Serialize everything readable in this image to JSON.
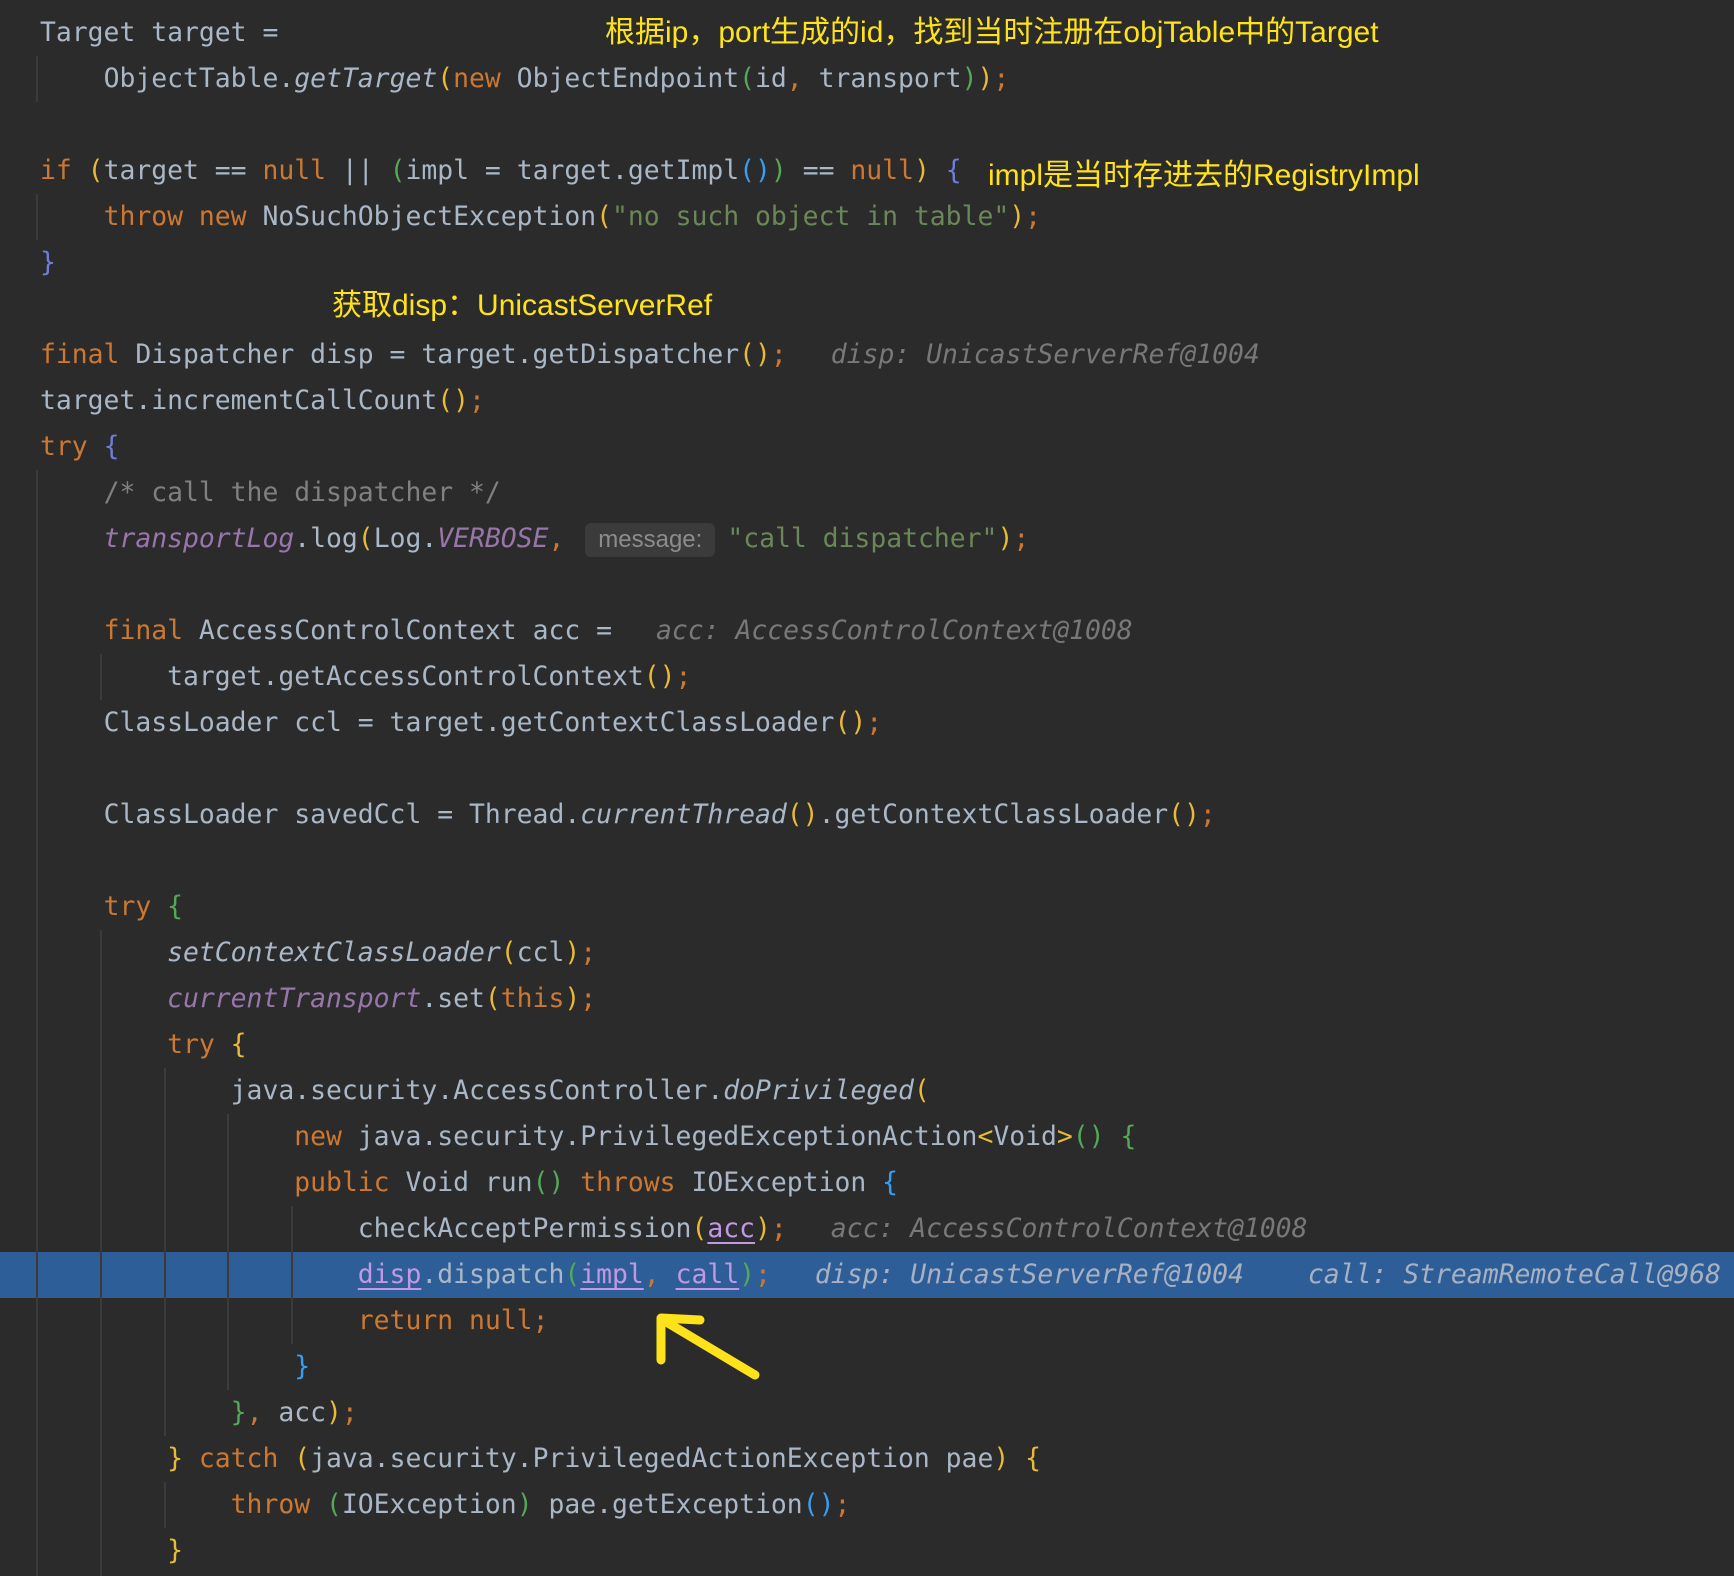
{
  "colors": {
    "background": "#2b2b2b",
    "default_text": "#a9b7c6",
    "execution_point": "#2e5e98",
    "annotation": "#ffe31a",
    "indent_guide": "#3b3b3b"
  },
  "annotations": [
    {
      "text": "根据ip，port生成的id，找到当时注册在objTable中的Target"
    },
    {
      "text": "impl是当时存进去的RegistryImpl"
    },
    {
      "text": "获取disp：UnicastServerRef"
    }
  ],
  "editor": {
    "lines": [
      {
        "tokens": [
          {
            "t": "Target target =",
            "c": "#a9b7c6"
          }
        ]
      },
      {
        "tokens": [
          {
            "t": "    "
          },
          {
            "t": "ObjectTable.",
            "c": "#a9b7c6"
          },
          {
            "t": "getTarget",
            "c": "#a9b7c6",
            "i": true
          },
          {
            "t": "(",
            "c": "#e8ba36"
          },
          {
            "t": "new",
            "c": "#cc7832"
          },
          {
            "t": " ObjectEndpoint",
            "c": "#a9b7c6"
          },
          {
            "t": "(",
            "c": "#54a857"
          },
          {
            "t": "id",
            "c": "#a9b7c6"
          },
          {
            "t": ",",
            "c": "#cc7832"
          },
          {
            "t": " transport",
            "c": "#a9b7c6"
          },
          {
            "t": ")",
            "c": "#54a857"
          },
          {
            "t": ")",
            "c": "#e8ba36"
          },
          {
            "t": ";",
            "c": "#cc7832"
          }
        ]
      },
      {
        "tokens": []
      },
      {
        "tokens": [
          {
            "t": "if",
            "c": "#cc7832"
          },
          {
            "t": " "
          },
          {
            "t": "(",
            "c": "#e8ba36"
          },
          {
            "t": "target == ",
            "c": "#a9b7c6"
          },
          {
            "t": "null",
            "c": "#cc7832"
          },
          {
            "t": " || ",
            "c": "#a9b7c6"
          },
          {
            "t": "(",
            "c": "#54a857"
          },
          {
            "t": "impl = target.getImpl",
            "c": "#a9b7c6"
          },
          {
            "t": "(",
            "c": "#359ff4"
          },
          {
            "t": ")",
            "c": "#359ff4"
          },
          {
            "t": ")",
            "c": "#54a857"
          },
          {
            "t": " == ",
            "c": "#a9b7c6"
          },
          {
            "t": "null",
            "c": "#cc7832"
          },
          {
            "t": ")",
            "c": "#e8ba36"
          },
          {
            "t": " "
          },
          {
            "t": "{",
            "c": "#6e7ed9"
          }
        ]
      },
      {
        "tokens": [
          {
            "t": "    "
          },
          {
            "t": "throw new",
            "c": "#cc7832"
          },
          {
            "t": " NoSuchObjectException",
            "c": "#a9b7c6"
          },
          {
            "t": "(",
            "c": "#e8ba36"
          },
          {
            "t": "\"no such object in table\"",
            "c": "#6a8759"
          },
          {
            "t": ")",
            "c": "#e8ba36"
          },
          {
            "t": ";",
            "c": "#cc7832"
          }
        ]
      },
      {
        "tokens": [
          {
            "t": "}",
            "c": "#6e7ed9"
          }
        ]
      },
      {
        "tokens": []
      },
      {
        "tokens": [
          {
            "t": "final",
            "c": "#cc7832"
          },
          {
            "t": " Dispatcher disp = target.getDispatcher",
            "c": "#a9b7c6"
          },
          {
            "t": "()",
            "c": "#e8ba36"
          },
          {
            "t": ";",
            "c": "#cc7832"
          }
        ],
        "hints": [
          "disp: UnicastServerRef@1004"
        ]
      },
      {
        "tokens": [
          {
            "t": "target.incrementCallCount",
            "c": "#a9b7c6"
          },
          {
            "t": "()",
            "c": "#e8ba36"
          },
          {
            "t": ";",
            "c": "#cc7832"
          }
        ]
      },
      {
        "tokens": [
          {
            "t": "try",
            "c": "#cc7832"
          },
          {
            "t": " "
          },
          {
            "t": "{",
            "c": "#6e7ed9"
          }
        ]
      },
      {
        "tokens": [
          {
            "t": "    "
          },
          {
            "t": "/* call the dispatcher */",
            "c": "#808080"
          }
        ]
      },
      {
        "tokens": [
          {
            "t": "    "
          },
          {
            "t": "transportLog",
            "c": "#9876aa",
            "i": true
          },
          {
            "t": ".log",
            "c": "#a9b7c6"
          },
          {
            "t": "(",
            "c": "#e8ba36"
          },
          {
            "t": "Log.",
            "c": "#a9b7c6"
          },
          {
            "t": "VERBOSE",
            "c": "#9876aa",
            "i": true
          },
          {
            "t": ",",
            "c": "#cc7832"
          },
          {
            "t": " "
          },
          {
            "t": "message:",
            "p": true
          },
          {
            "t": "\"call dispatcher\"",
            "c": "#6a8759"
          },
          {
            "t": ")",
            "c": "#e8ba36"
          },
          {
            "t": ";",
            "c": "#cc7832"
          }
        ]
      },
      {
        "tokens": []
      },
      {
        "tokens": [
          {
            "t": "    "
          },
          {
            "t": "final",
            "c": "#cc7832"
          },
          {
            "t": " AccessControlContext acc =",
            "c": "#a9b7c6"
          }
        ],
        "hints": [
          "acc: AccessControlContext@1008"
        ]
      },
      {
        "tokens": [
          {
            "t": "        "
          },
          {
            "t": "target.getAccessControlContext",
            "c": "#a9b7c6"
          },
          {
            "t": "()",
            "c": "#e8ba36"
          },
          {
            "t": ";",
            "c": "#cc7832"
          }
        ]
      },
      {
        "tokens": [
          {
            "t": "    "
          },
          {
            "t": "ClassLoader ccl = target.getContextClassLoader",
            "c": "#a9b7c6"
          },
          {
            "t": "()",
            "c": "#e8ba36"
          },
          {
            "t": ";",
            "c": "#cc7832"
          }
        ]
      },
      {
        "tokens": []
      },
      {
        "tokens": [
          {
            "t": "    "
          },
          {
            "t": "ClassLoader savedCcl = Thread.",
            "c": "#a9b7c6"
          },
          {
            "t": "currentThread",
            "c": "#a9b7c6",
            "i": true
          },
          {
            "t": "()",
            "c": "#e8ba36"
          },
          {
            "t": ".getContextClassLoader",
            "c": "#a9b7c6"
          },
          {
            "t": "()",
            "c": "#e8ba36"
          },
          {
            "t": ";",
            "c": "#cc7832"
          }
        ]
      },
      {
        "tokens": []
      },
      {
        "tokens": [
          {
            "t": "    "
          },
          {
            "t": "try",
            "c": "#cc7832"
          },
          {
            "t": " "
          },
          {
            "t": "{",
            "c": "#54a857"
          }
        ]
      },
      {
        "tokens": [
          {
            "t": "        "
          },
          {
            "t": "setContextClassLoader",
            "c": "#a9b7c6",
            "i": true
          },
          {
            "t": "(",
            "c": "#e8ba36"
          },
          {
            "t": "ccl",
            "c": "#a9b7c6"
          },
          {
            "t": ")",
            "c": "#e8ba36"
          },
          {
            "t": ";",
            "c": "#cc7832"
          }
        ]
      },
      {
        "tokens": [
          {
            "t": "        "
          },
          {
            "t": "currentTransport",
            "c": "#9876aa",
            "i": true
          },
          {
            "t": ".set",
            "c": "#a9b7c6"
          },
          {
            "t": "(",
            "c": "#e8ba36"
          },
          {
            "t": "this",
            "c": "#cc7832"
          },
          {
            "t": ")",
            "c": "#e8ba36"
          },
          {
            "t": ";",
            "c": "#cc7832"
          }
        ]
      },
      {
        "tokens": [
          {
            "t": "        "
          },
          {
            "t": "try",
            "c": "#cc7832"
          },
          {
            "t": " "
          },
          {
            "t": "{",
            "c": "#e8ba36"
          }
        ]
      },
      {
        "tokens": [
          {
            "t": "            "
          },
          {
            "t": "java.security.AccessController.",
            "c": "#a9b7c6"
          },
          {
            "t": "doPrivileged",
            "c": "#a9b7c6",
            "i": true
          },
          {
            "t": "(",
            "c": "#e8ba36"
          }
        ]
      },
      {
        "tokens": [
          {
            "t": "                "
          },
          {
            "t": "new",
            "c": "#cc7832"
          },
          {
            "t": " java.security.PrivilegedExceptionAction",
            "c": "#a9b7c6"
          },
          {
            "t": "<",
            "c": "#e8ba36"
          },
          {
            "t": "Void",
            "c": "#a9b7c6"
          },
          {
            "t": ">",
            "c": "#e8ba36"
          },
          {
            "t": "()",
            "c": "#54a857"
          },
          {
            "t": " "
          },
          {
            "t": "{",
            "c": "#54a857"
          }
        ]
      },
      {
        "tokens": [
          {
            "t": "                "
          },
          {
            "t": "public",
            "c": "#cc7832"
          },
          {
            "t": " Void run",
            "c": "#a9b7c6"
          },
          {
            "t": "()",
            "c": "#54a857"
          },
          {
            "t": " "
          },
          {
            "t": "throws",
            "c": "#cc7832"
          },
          {
            "t": " IOException ",
            "c": "#a9b7c6"
          },
          {
            "t": "{",
            "c": "#359ff4"
          }
        ]
      },
      {
        "tokens": [
          {
            "t": "                    "
          },
          {
            "t": "checkAcceptPermission",
            "c": "#a9b7c6"
          },
          {
            "t": "(",
            "c": "#e8ba36"
          },
          {
            "t": "acc",
            "c": "#c198e3",
            "u": true
          },
          {
            "t": ")",
            "c": "#e8ba36"
          },
          {
            "t": ";",
            "c": "#cc7832"
          }
        ],
        "hints": [
          "acc: AccessControlContext@1008"
        ]
      },
      {
        "execution_point": true,
        "tokens": [
          {
            "t": "                    "
          },
          {
            "t": "disp",
            "c": "#c198e3",
            "u": true
          },
          {
            "t": ".dispatch",
            "c": "#a9b7c6"
          },
          {
            "t": "(",
            "c": "#54a857"
          },
          {
            "t": "impl",
            "c": "#c198e3",
            "u": true
          },
          {
            "t": ",",
            "c": "#cc7832"
          },
          {
            "t": " "
          },
          {
            "t": "call",
            "c": "#c198e3",
            "u": true
          },
          {
            "t": ")",
            "c": "#54a857"
          },
          {
            "t": ";",
            "c": "#cc7832"
          }
        ],
        "hints": [
          "disp: UnicastServerRef@1004",
          "call: StreamRemoteCall@968"
        ]
      },
      {
        "tokens": [
          {
            "t": "                    "
          },
          {
            "t": "return null",
            "c": "#cc7832"
          },
          {
            "t": ";",
            "c": "#cc7832"
          }
        ]
      },
      {
        "tokens": [
          {
            "t": "                "
          },
          {
            "t": "}",
            "c": "#359ff4"
          }
        ]
      },
      {
        "tokens": [
          {
            "t": "            "
          },
          {
            "t": "}",
            "c": "#54a857"
          },
          {
            "t": ",",
            "c": "#cc7832"
          },
          {
            "t": " acc",
            "c": "#a9b7c6"
          },
          {
            "t": ")",
            "c": "#e8ba36"
          },
          {
            "t": ";",
            "c": "#cc7832"
          }
        ]
      },
      {
        "tokens": [
          {
            "t": "        "
          },
          {
            "t": "}",
            "c": "#e8ba36"
          },
          {
            "t": " "
          },
          {
            "t": "catch",
            "c": "#cc7832"
          },
          {
            "t": " "
          },
          {
            "t": "(",
            "c": "#e8ba36"
          },
          {
            "t": "java.security.PrivilegedActionException pae",
            "c": "#a9b7c6"
          },
          {
            "t": ")",
            "c": "#e8ba36"
          },
          {
            "t": " "
          },
          {
            "t": "{",
            "c": "#e8ba36"
          }
        ]
      },
      {
        "tokens": [
          {
            "t": "            "
          },
          {
            "t": "throw",
            "c": "#cc7832"
          },
          {
            "t": " "
          },
          {
            "t": "(",
            "c": "#54a857"
          },
          {
            "t": "IOException",
            "c": "#a9b7c6"
          },
          {
            "t": ")",
            "c": "#54a857"
          },
          {
            "t": " pae.getException",
            "c": "#a9b7c6"
          },
          {
            "t": "()",
            "c": "#359ff4"
          },
          {
            "t": ";",
            "c": "#cc7832"
          }
        ]
      },
      {
        "tokens": [
          {
            "t": "        "
          },
          {
            "t": "}",
            "c": "#e8ba36"
          }
        ]
      }
    ]
  }
}
